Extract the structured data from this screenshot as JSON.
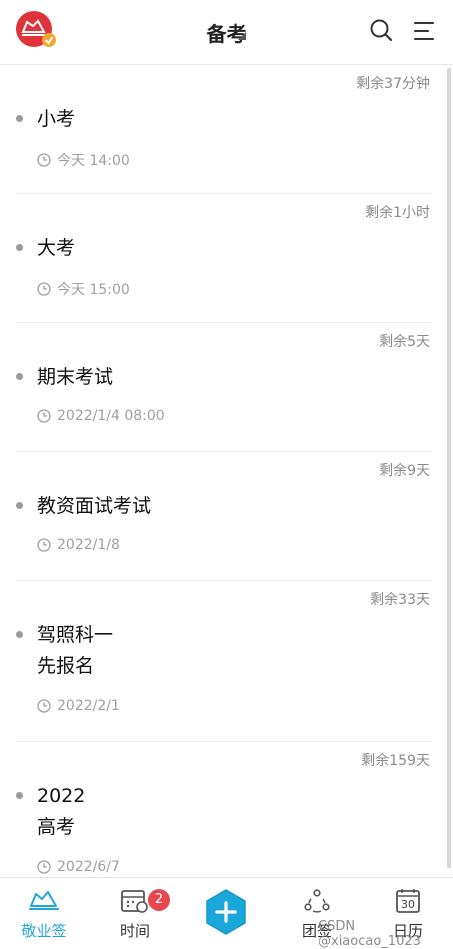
{
  "header": {
    "title": "备考",
    "icons": {
      "logo": "app-logo",
      "search": "search-icon",
      "menu": "menu-icon"
    },
    "accent": "#e0323a"
  },
  "events": [
    {
      "remain": "剩余37分钟",
      "name_lines": [
        "小考"
      ],
      "time": "今天 14:00"
    },
    {
      "remain": "剩余1小时",
      "name_lines": [
        "大考"
      ],
      "time": "今天 15:00"
    },
    {
      "remain": "剩余5天",
      "name_lines": [
        "期末考试"
      ],
      "time": "2022/1/4 08:00"
    },
    {
      "remain": "剩余9天",
      "name_lines": [
        "教资面试考试"
      ],
      "time": "2022/1/8"
    },
    {
      "remain": "剩余33天",
      "name_lines": [
        "驾照科一",
        "先报名"
      ],
      "time": "2022/2/1"
    },
    {
      "remain": "剩余159天",
      "name_lines": [
        "2022",
        "高考"
      ],
      "time": "2022/6/7"
    }
  ],
  "tabbar": {
    "tabs": [
      {
        "label": "敬业签",
        "icon": "boat-icon",
        "active": true
      },
      {
        "label": "时间",
        "icon": "calendar-clock-icon",
        "badge": "2"
      },
      {
        "label": "",
        "icon": "add-icon"
      },
      {
        "label": "团签",
        "icon": "team-icon"
      },
      {
        "label": "日历",
        "icon": "calendar-icon",
        "day": "30"
      }
    ],
    "accent": "#22a7dc"
  },
  "watermark": "CSDN @xiaocao_1023"
}
